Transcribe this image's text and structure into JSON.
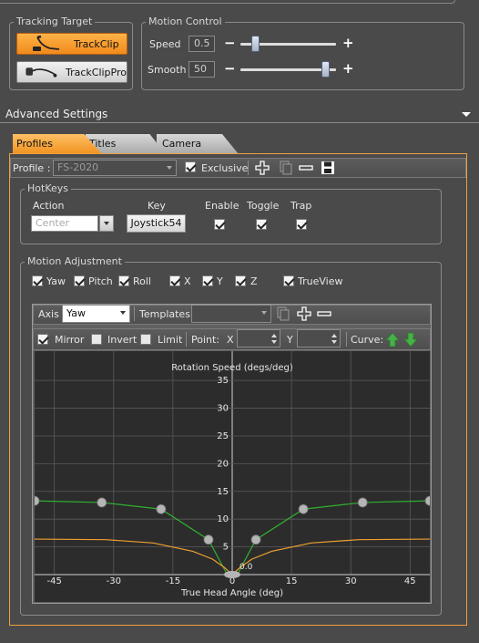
{
  "tracking_target": {
    "title": "Tracking Target",
    "buttons": [
      {
        "label": "TrackClip",
        "active": true
      },
      {
        "label": "TrackClipPro",
        "active": false
      }
    ]
  },
  "motion_control": {
    "title": "Motion Control",
    "speed": {
      "label": "Speed",
      "value": "0.5",
      "level": 0.12
    },
    "smooth": {
      "label": "Smooth",
      "value": "50",
      "level": 0.93
    },
    "minus": "−",
    "plus": "+"
  },
  "advanced_settings": {
    "title": "Advanced Settings"
  },
  "tabs": [
    "Profiles",
    "Titles",
    "Camera"
  ],
  "profile": {
    "label": "Profile :",
    "value": "FS-2020",
    "exclusive_label": "Exclusive",
    "exclusive_checked": true
  },
  "hotkeys": {
    "title": "HotKeys",
    "columns": [
      "Action",
      "Key",
      "Enable",
      "Toggle",
      "Trap"
    ],
    "action_value": "Center",
    "key_value": "Joystick54",
    "enable": true,
    "toggle": true,
    "trap": true
  },
  "motion_adjustment": {
    "title": "Motion Adjustment",
    "axes": [
      {
        "label": "Yaw",
        "checked": true
      },
      {
        "label": "Pitch",
        "checked": true
      },
      {
        "label": "Roll",
        "checked": true
      },
      {
        "label": "X",
        "checked": true
      },
      {
        "label": "Y",
        "checked": true
      },
      {
        "label": "Z",
        "checked": true
      },
      {
        "label": "TrueView",
        "checked": true
      }
    ]
  },
  "curve_toolbar": {
    "axis_label": "Axis",
    "axis_value": "Yaw",
    "templates_label": "Templates",
    "templates_value": "",
    "mirror_label": "Mirror",
    "mirror_checked": true,
    "invert_label": "Invert",
    "invert_checked": false,
    "limit_label": "Limit",
    "limit_checked": false,
    "point_label": "Point:",
    "x_label": "X",
    "y_label": "Y",
    "curve_label": "Curve:"
  },
  "curve_graph": {
    "title": "Rotation Speed (degs/deg)",
    "xlabel": "True Head Angle (deg)",
    "x_ticks": [
      "-45",
      "-30",
      "-15",
      "0",
      "15",
      "30",
      "45"
    ],
    "y_ticks": [
      "35",
      "30",
      "25",
      "20",
      "15",
      "10",
      "5"
    ],
    "origin_label": "0.0",
    "colors": {
      "curve": "#2fb12f",
      "output": "#f0a030",
      "point": "#b5b5b5",
      "background": "#2c2c2c"
    }
  },
  "chart_data": {
    "type": "line",
    "title": "Rotation Speed (degs/deg)",
    "xlabel": "True Head Angle (deg)",
    "ylabel": "",
    "xlim": [
      -50,
      50
    ],
    "ylim": [
      0,
      37
    ],
    "x_ticks": [
      -45,
      -30,
      -15,
      0,
      15,
      30,
      45
    ],
    "y_ticks": [
      5,
      10,
      15,
      20,
      25,
      30,
      35
    ],
    "series": [
      {
        "color": "#2fb12f",
        "points": [
          [
            -50,
            13.3
          ],
          [
            -33,
            13.0
          ],
          [
            -18,
            11.8
          ],
          [
            -6,
            6.3
          ],
          [
            -1.5,
            0.3
          ],
          [
            0,
            0
          ],
          [
            1.5,
            0.3
          ],
          [
            6,
            6.3
          ],
          [
            18,
            11.8
          ],
          [
            33,
            13.0
          ],
          [
            50,
            13.3
          ]
        ],
        "control_points": true
      },
      {
        "color": "#f0a030",
        "points": [
          [
            -50,
            6.4
          ],
          [
            -32,
            6.3
          ],
          [
            -20,
            5.7
          ],
          [
            -10,
            4.2
          ],
          [
            -5,
            2.8
          ],
          [
            -2,
            1.3
          ],
          [
            0,
            0
          ],
          [
            2,
            1.3
          ],
          [
            5,
            2.8
          ],
          [
            10,
            4.2
          ],
          [
            20,
            5.7
          ],
          [
            32,
            6.3
          ],
          [
            50,
            6.4
          ]
        ],
        "control_points": false
      }
    ]
  }
}
